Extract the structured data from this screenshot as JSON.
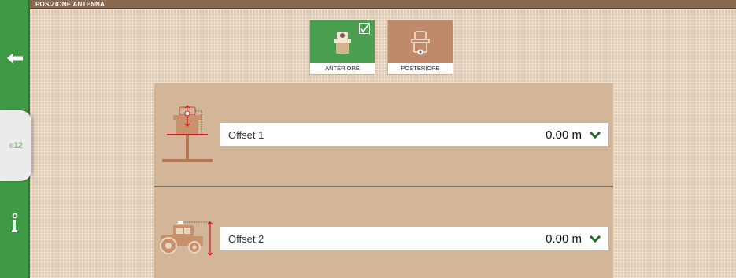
{
  "header": {
    "title": "POSIZIONE ANTENNA"
  },
  "sidebar": {
    "back_icon": "back-arrow-icon",
    "page_indicator": {
      "prefix": "e",
      "number": "12"
    },
    "info_icon": "info-icon"
  },
  "position_options": [
    {
      "label": "ANTERIORE",
      "icon": "tractor-antenna-front-icon",
      "selected": true
    },
    {
      "label": "POSTERIORE",
      "icon": "tractor-antenna-rear-icon",
      "selected": false
    }
  ],
  "offsets": [
    {
      "label": "Offset 1",
      "value": "0.00 m",
      "icon": "lateral-offset-icon"
    },
    {
      "label": "Offset 2",
      "value": "0.00 m",
      "icon": "height-offset-icon"
    }
  ],
  "colors": {
    "sidebar": "#3f9a45",
    "selected_option": "#4a9e4f",
    "unselected_option": "#c08a6a",
    "accent_chevron": "#1f6b2a",
    "offset_marker": "#d22020"
  }
}
